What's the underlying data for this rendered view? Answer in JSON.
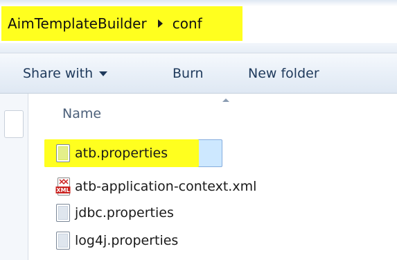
{
  "address_bar": {
    "crumbs": [
      "AimTemplateBuilder",
      "conf"
    ],
    "highlight_color": "#ffff1f"
  },
  "toolbar": {
    "share_label": "Share with",
    "burn_label": "Burn",
    "new_folder_label": "New folder"
  },
  "file_list": {
    "column_name": "Name",
    "sort": "ascending",
    "selected_color": "#cde8ff",
    "files": [
      {
        "name": "atb.properties",
        "icon": "properties-file-icon",
        "selected": true,
        "highlighted": true
      },
      {
        "name": "atb-application-context.xml",
        "icon": "xml-file-icon",
        "selected": false,
        "highlighted": false
      },
      {
        "name": "jdbc.properties",
        "icon": "properties-file-icon",
        "selected": false,
        "highlighted": false
      },
      {
        "name": "log4j.properties",
        "icon": "properties-file-icon",
        "selected": false,
        "highlighted": false
      }
    ]
  }
}
